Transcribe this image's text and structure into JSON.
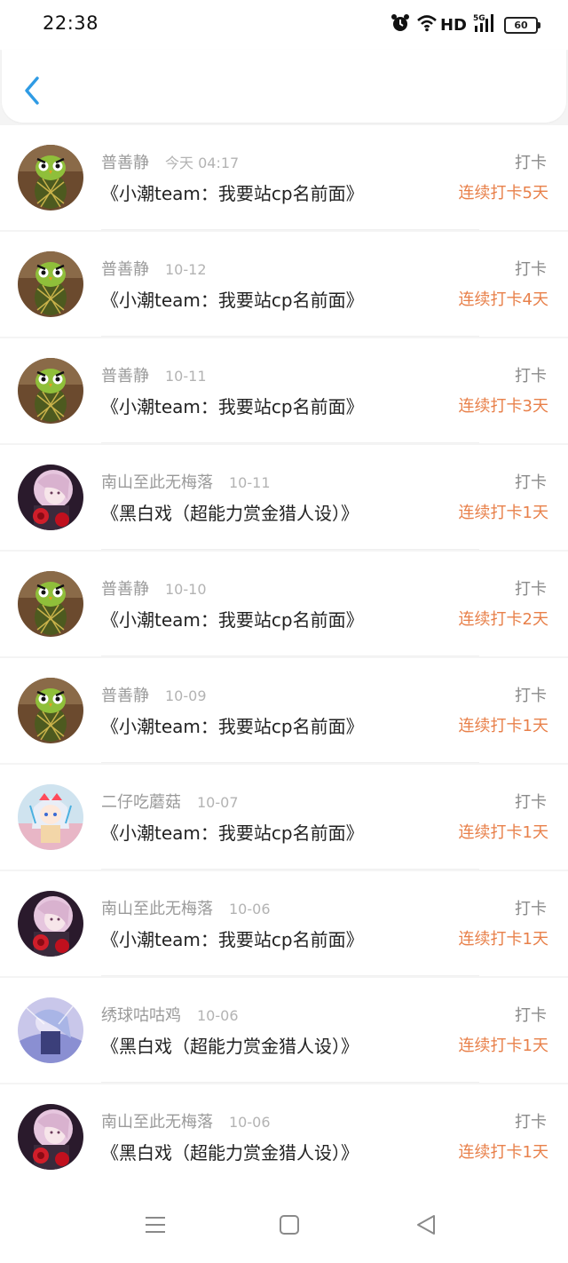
{
  "status_bar": {
    "time": "22:38",
    "icons": [
      "alarm-icon",
      "wifi-icon",
      "signal-5g-icon",
      "battery-icon"
    ],
    "network_label": "HD",
    "signal_label": "5G",
    "battery": "60"
  },
  "header": {
    "back_icon": "chevron-left-icon",
    "accent": "#2f9be4"
  },
  "colors": {
    "streak": "#e8804a",
    "action": "#8a8a8a"
  },
  "entries": [
    {
      "user": "普善静",
      "date": "今天 04:17",
      "title": "《小潮team：我要站cp名前面》",
      "action": "打卡",
      "streak": "连续打卡5天",
      "avatar": "pineapple-owl"
    },
    {
      "user": "普善静",
      "date": "10-12",
      "title": "《小潮team：我要站cp名前面》",
      "action": "打卡",
      "streak": "连续打卡4天",
      "avatar": "pineapple-owl"
    },
    {
      "user": "普善静",
      "date": "10-11",
      "title": "《小潮team：我要站cp名前面》",
      "action": "打卡",
      "streak": "连续打卡3天",
      "avatar": "pineapple-owl"
    },
    {
      "user": "南山至此无梅落",
      "date": "10-11",
      "title": "《黑白戏（超能力赏金猎人设）》",
      "action": "打卡",
      "streak": "连续打卡1天",
      "avatar": "anime-rose"
    },
    {
      "user": "普善静",
      "date": "10-10",
      "title": "《小潮team：我要站cp名前面》",
      "action": "打卡",
      "streak": "连续打卡2天",
      "avatar": "pineapple-owl"
    },
    {
      "user": "普善静",
      "date": "10-09",
      "title": "《小潮team：我要站cp名前面》",
      "action": "打卡",
      "streak": "连续打卡1天",
      "avatar": "pineapple-owl"
    },
    {
      "user": "二仔吃蘑菇",
      "date": "10-07",
      "title": "《小潮team：我要站cp名前面》",
      "action": "打卡",
      "streak": "连续打卡1天",
      "avatar": "chibi-girl"
    },
    {
      "user": "南山至此无梅落",
      "date": "10-06",
      "title": "《小潮team：我要站cp名前面》",
      "action": "打卡",
      "streak": "连续打卡1天",
      "avatar": "anime-rose"
    },
    {
      "user": "绣球咕咕鸡",
      "date": "10-06",
      "title": "《黑白戏（超能力赏金猎人设）》",
      "action": "打卡",
      "streak": "连续打卡1天",
      "avatar": "anime-blue"
    },
    {
      "user": "南山至此无梅落",
      "date": "10-06",
      "title": "《黑白戏（超能力赏金猎人设）》",
      "action": "打卡",
      "streak": "连续打卡1天",
      "avatar": "anime-rose"
    }
  ],
  "nav_bar": {
    "icons": [
      "menu-icon",
      "home-square-icon",
      "back-triangle-icon"
    ]
  }
}
